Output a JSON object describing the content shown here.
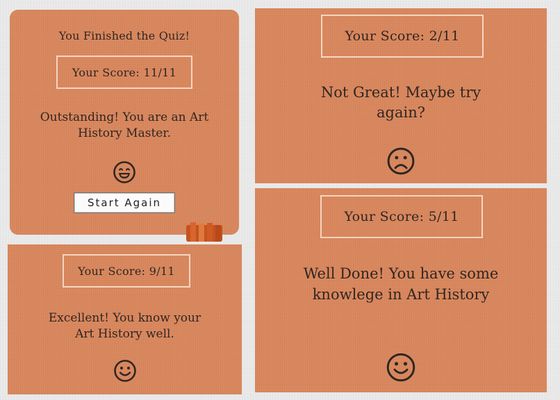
{
  "panels": {
    "finished": {
      "heading": "You Finished the Quiz!",
      "score": "Your Score: 11/11",
      "message": "Outstanding! You are an Art History Master.",
      "face_icon": "laughing-face-icon",
      "start_again_label": "Start Again"
    },
    "score_9": {
      "score": "Your Score: 9/11",
      "message": "Excellent! You know your Art History well.",
      "face_icon": "smiley-face-icon"
    },
    "score_2": {
      "score": "Your Score: 2/11",
      "message": "Not Great! Maybe try again?",
      "face_icon": "frowning-face-icon"
    },
    "score_5": {
      "score": "Your Score: 5/11",
      "message": "Well Done! You have some knowlege in Art History",
      "face_icon": "smiley-face-icon"
    }
  },
  "colors": {
    "panel_bg": "#d9865c",
    "page_bg": "#ebebeb",
    "text": "#2f2622",
    "border": "#ffece0"
  }
}
